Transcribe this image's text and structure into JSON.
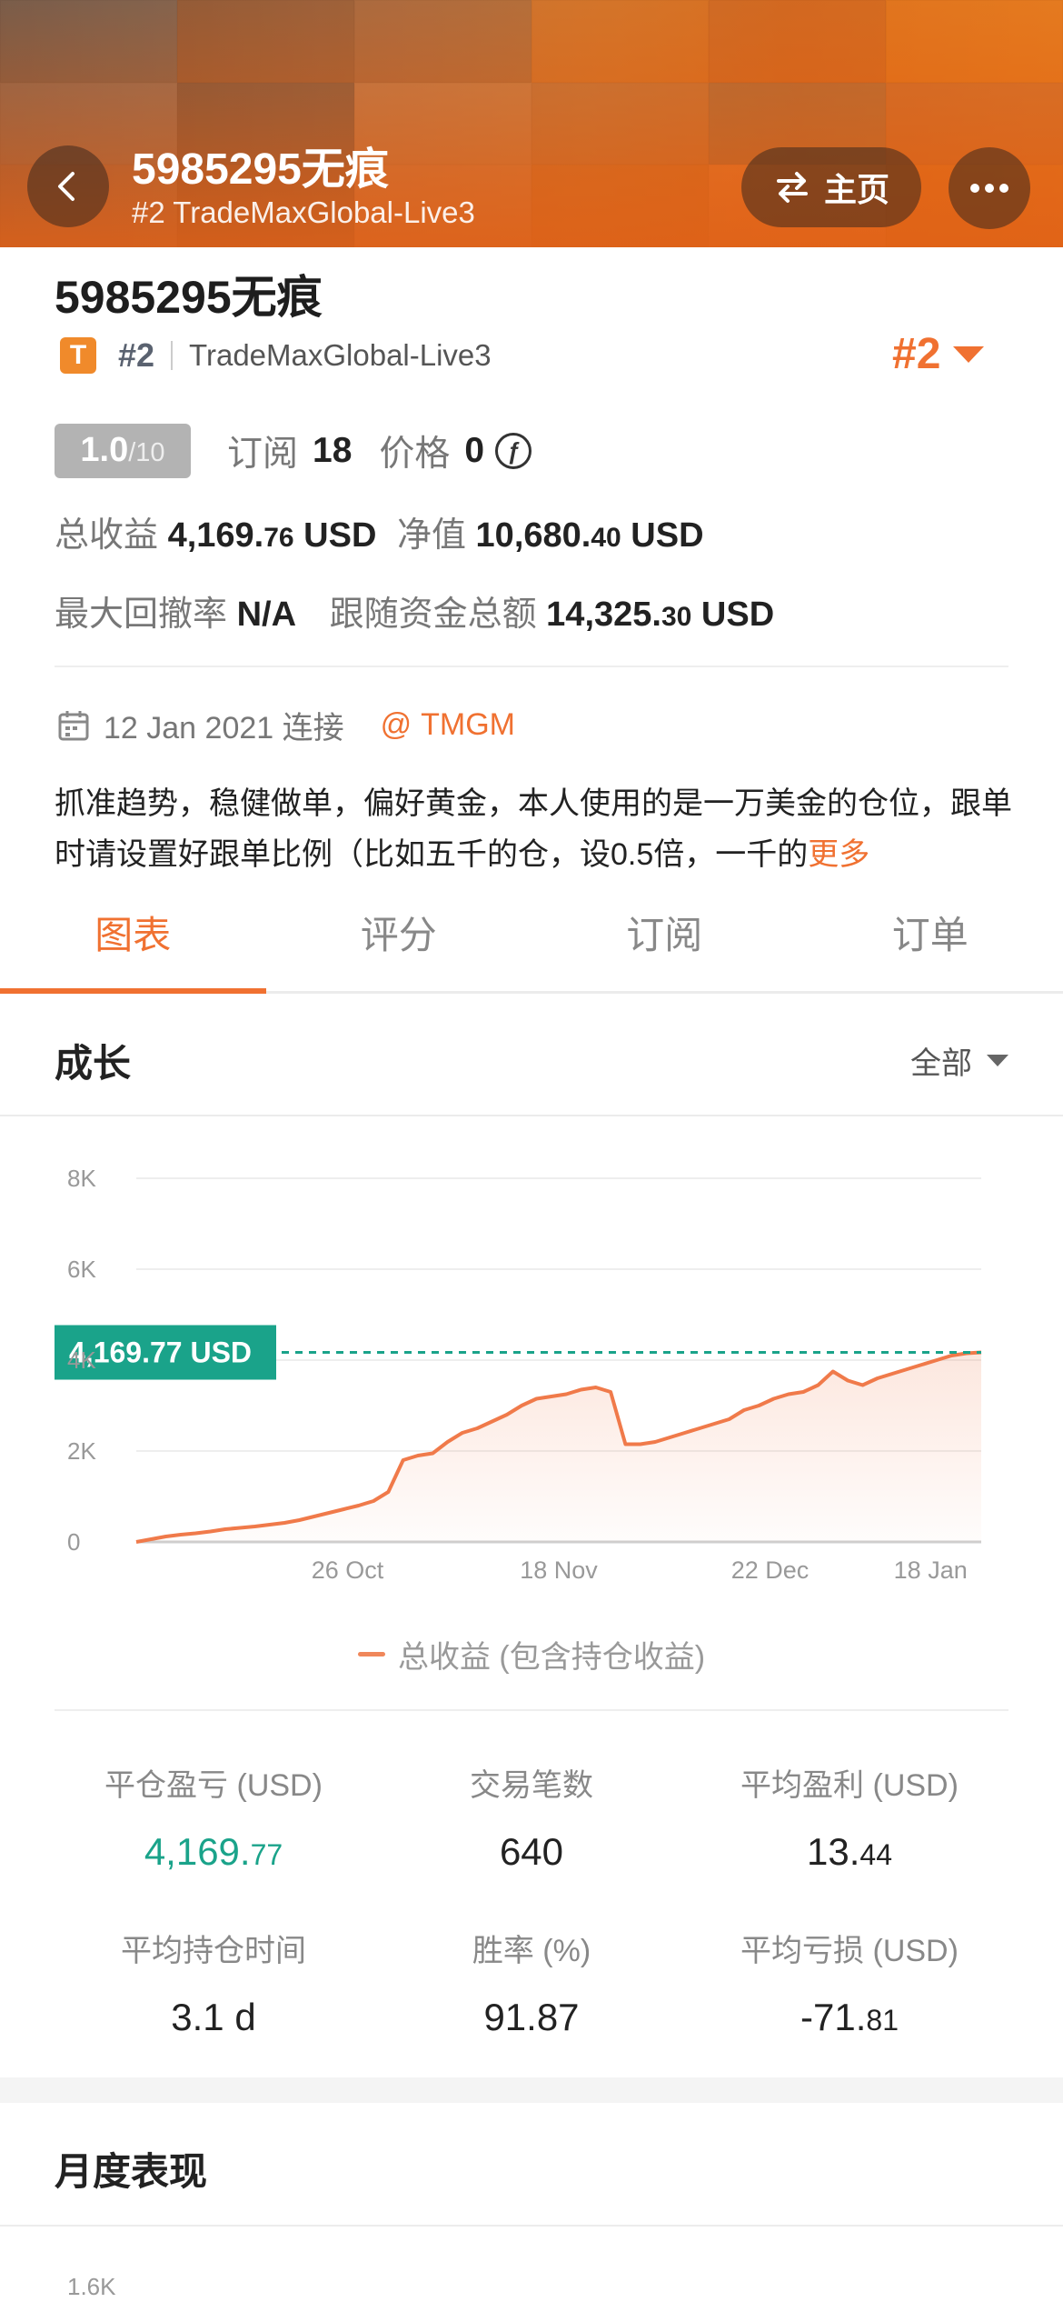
{
  "header": {
    "title": "5985295无痕",
    "subtitle": "#2 TradeMaxGlobal-Live3",
    "home_label": "主页",
    "back_icon": "chevron-left-icon",
    "swap_icon": "swap-arrows-icon",
    "more_icon": "ellipsis-icon"
  },
  "profile": {
    "name": "5985295无痕",
    "badge_letter": "T",
    "rank_small": "#2",
    "broker": "TradeMaxGlobal-Live3",
    "rank_big": "#2",
    "score_main": "1.0",
    "score_denom": "/10",
    "subscribe_label": "订阅",
    "subscribe_value": "18",
    "price_label": "价格",
    "price_value": "0",
    "currency_symbol": "ƒ",
    "total_profit_label": "总收益",
    "total_profit_int": "4,169.",
    "total_profit_dec": "76",
    "total_profit_unit": "USD",
    "equity_label": "净值",
    "equity_int": "10,680.",
    "equity_dec": "40",
    "equity_unit": "USD",
    "drawdown_label": "最大回撤率",
    "drawdown_value": "N/A",
    "follow_funds_label": "跟随资金总额",
    "follow_funds_int": "14,325.",
    "follow_funds_dec": "30",
    "follow_funds_unit": "USD",
    "connect_date": "12 Jan 2021 连接",
    "broker_short": "TMGM",
    "description": "抓准趋势，稳健做单，偏好黄金，本人使用的是一万美金的仓位，跟单时请设置好跟单比例（比如五千的仓，设0.5倍，一千的",
    "more_link": "更多"
  },
  "tabs": [
    {
      "label": "图表",
      "active": true
    },
    {
      "label": "评分",
      "active": false
    },
    {
      "label": "订阅",
      "active": false
    },
    {
      "label": "订单",
      "active": false
    }
  ],
  "growth": {
    "title": "成长",
    "filter": "全部"
  },
  "chart_data": {
    "type": "area",
    "x_ticks": [
      "26 Oct",
      "18 Nov",
      "22 Dec",
      "18 Jan"
    ],
    "y_ticks": [
      "0",
      "2K",
      "4K",
      "6K",
      "8K"
    ],
    "ylim": [
      0,
      8000
    ],
    "current_label": "4,169.77 USD",
    "current_value": 4169.77,
    "legend": "总收益 (包含持仓收益)",
    "series": [
      {
        "values": [
          0,
          60,
          120,
          160,
          190,
          230,
          280,
          310,
          340,
          380,
          420,
          480,
          560,
          640,
          720,
          800,
          900,
          1100,
          1800,
          1900,
          1950,
          2200,
          2400,
          2500,
          2650,
          2800,
          3000,
          3150,
          3200,
          3250,
          3350,
          3400,
          3300,
          2150,
          2150,
          2200,
          2300,
          2400,
          2500,
          2600,
          2700,
          2900,
          3000,
          3150,
          3250,
          3300,
          3450,
          3750,
          3550,
          3450,
          3600,
          3700,
          3800,
          3900,
          4000,
          4100,
          4150,
          4169.77
        ]
      }
    ],
    "grid": true
  },
  "stats": [
    {
      "label": "平仓盈亏 (USD)",
      "int": "4,169.",
      "dec": "77",
      "green": true
    },
    {
      "label": "交易笔数",
      "int": "640",
      "dec": "",
      "green": false
    },
    {
      "label": "平均盈利 (USD)",
      "int": "13.",
      "dec": "44",
      "green": false
    },
    {
      "label": "平均持仓时间",
      "int": "3.1 d",
      "dec": "",
      "green": false
    },
    {
      "label": "胜率 (%)",
      "int": "91.87",
      "dec": "",
      "green": false
    },
    {
      "label": "平均亏损 (USD)",
      "int": "-71.",
      "dec": "81",
      "green": false
    }
  ],
  "monthly": {
    "title": "月度表现",
    "y_top_label": "1.6K"
  },
  "colors": {
    "accent": "#f07131",
    "green": "#1aa38a",
    "line": "#f07a4a"
  }
}
